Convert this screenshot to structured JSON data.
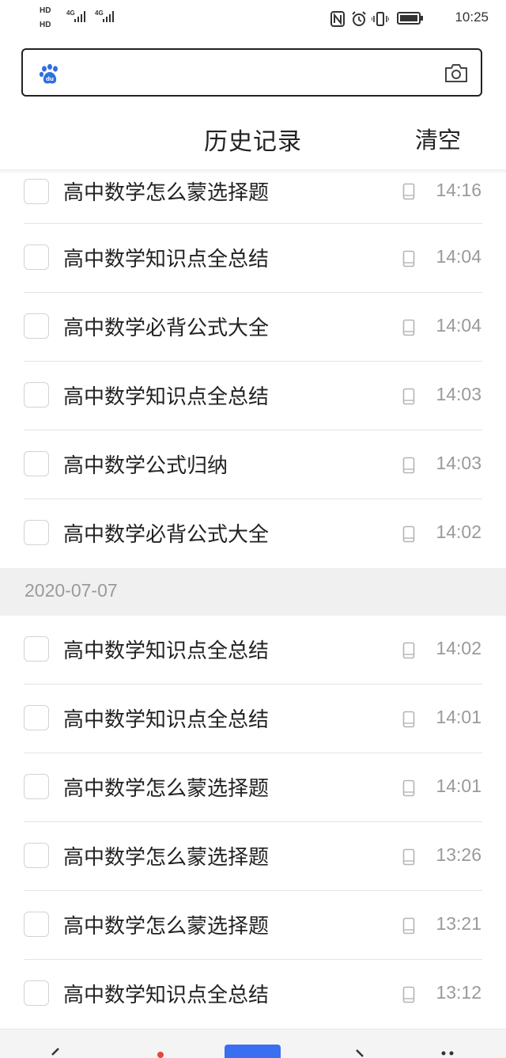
{
  "status_bar": {
    "sim1_label": "HD",
    "sim2_label": "HD",
    "sim1_net": "4G",
    "sim2_net": "4G",
    "time": "10:25",
    "icons": [
      "nfc-icon",
      "alarm-icon",
      "vibrate-icon",
      "battery-icon"
    ]
  },
  "search": {
    "logo": "baidu-paw-logo",
    "camera": "camera-icon",
    "value": ""
  },
  "header": {
    "title": "历史记录",
    "clear_label": "清空"
  },
  "history": {
    "top_items": [
      {
        "title": "高中数学怎么蒙选择题",
        "time": "14:16"
      },
      {
        "title": "高中数学知识点全总结",
        "time": "14:04"
      },
      {
        "title": "高中数学必背公式大全",
        "time": "14:04"
      },
      {
        "title": "高中数学知识点全总结",
        "time": "14:03"
      },
      {
        "title": "高中数学公式归纳",
        "time": "14:03"
      },
      {
        "title": "高中数学必背公式大全",
        "time": "14:02"
      }
    ],
    "date_label": "2020-07-07",
    "dated_items": [
      {
        "title": "高中数学知识点全总结",
        "time": "14:02"
      },
      {
        "title": "高中数学知识点全总结",
        "time": "14:01"
      },
      {
        "title": "高中数学怎么蒙选择题",
        "time": "14:01"
      },
      {
        "title": "高中数学怎么蒙选择题",
        "time": "13:26"
      },
      {
        "title": "高中数学怎么蒙选择题",
        "time": "13:21"
      },
      {
        "title": "高中数学知识点全总结",
        "time": "13:12"
      }
    ]
  },
  "colors": {
    "accent": "#3b6ff2",
    "baidu_blue": "#2f6fe0",
    "time_gray": "#9a9a9a",
    "divider": "#e4e4e4",
    "date_bg": "#f0f0f0"
  }
}
